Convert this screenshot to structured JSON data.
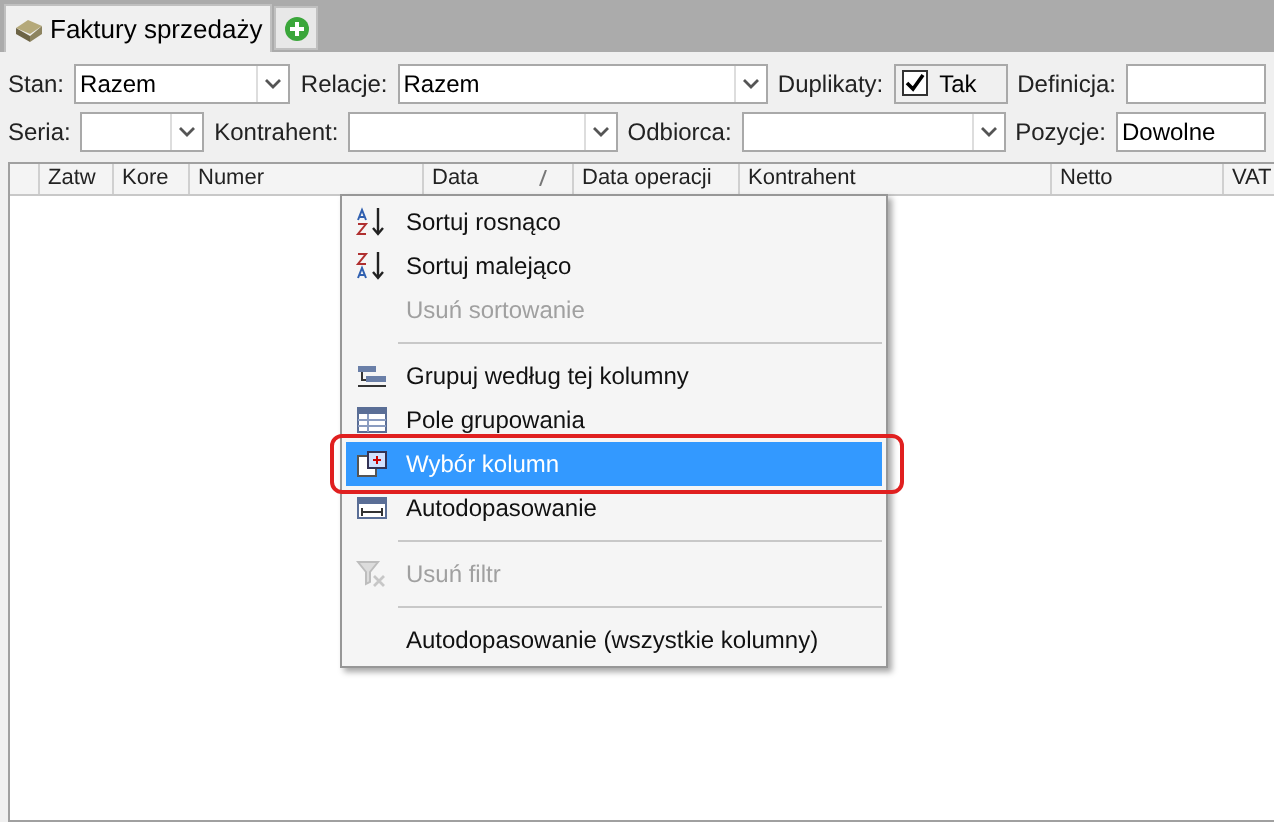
{
  "tabs": [
    {
      "label": "Faktury sprzedaży",
      "selected": true
    },
    {
      "kind": "add"
    }
  ],
  "filter_rows": [
    [
      {
        "label": "Stan:",
        "kind": "combo",
        "value": "Razem"
      },
      {
        "label": "Relacje:",
        "kind": "combo",
        "value": "Razem"
      },
      {
        "label": "Duplikaty:",
        "kind": "checkbox",
        "checked": true,
        "text": "Tak"
      },
      {
        "label": "Definicja:",
        "kind": "text"
      }
    ],
    [
      {
        "label": "Seria:",
        "kind": "combo"
      },
      {
        "label": "Kontrahent:",
        "kind": "combo"
      },
      {
        "label": "Odbiorca:",
        "kind": "combo"
      },
      {
        "label": "Pozycje:",
        "kind": "text",
        "value": "Dowolne"
      }
    ]
  ],
  "table": {
    "columns": [
      {},
      {
        "label": "Zatw"
      },
      {
        "label": "Kore"
      },
      {
        "label": "Numer"
      },
      {
        "label": "Data",
        "sorted": true
      },
      {
        "label": "Data operacji"
      },
      {
        "label": "Kontrahent"
      },
      {
        "label": "Netto"
      },
      {
        "label": "VAT"
      }
    ]
  },
  "context_menu": {
    "items": [
      {
        "kind": "item",
        "label": "Sortuj rosnąco",
        "disabled": false,
        "selected": false
      },
      {
        "kind": "item",
        "label": "Sortuj malejąco",
        "disabled": false,
        "selected": false
      },
      {
        "kind": "item",
        "label": "Usuń sortowanie",
        "disabled": true,
        "selected": false
      },
      {
        "kind": "separator"
      },
      {
        "kind": "item",
        "label": "Grupuj według tej kolumny",
        "disabled": false,
        "selected": false
      },
      {
        "kind": "item",
        "label": "Pole grupowania",
        "disabled": false,
        "selected": false
      },
      {
        "kind": "item",
        "label": "Wybór kolumn",
        "disabled": false,
        "selected": true,
        "outlined": true
      },
      {
        "kind": "item",
        "label": "Autodopasowanie",
        "disabled": false,
        "selected": false
      },
      {
        "kind": "separator"
      },
      {
        "kind": "item",
        "label": "Usuń filtr",
        "disabled": true,
        "selected": false
      },
      {
        "kind": "separator"
      },
      {
        "kind": "item",
        "label": "Autodopasowanie (wszystkie kolumny)",
        "disabled": false,
        "selected": false
      }
    ]
  }
}
